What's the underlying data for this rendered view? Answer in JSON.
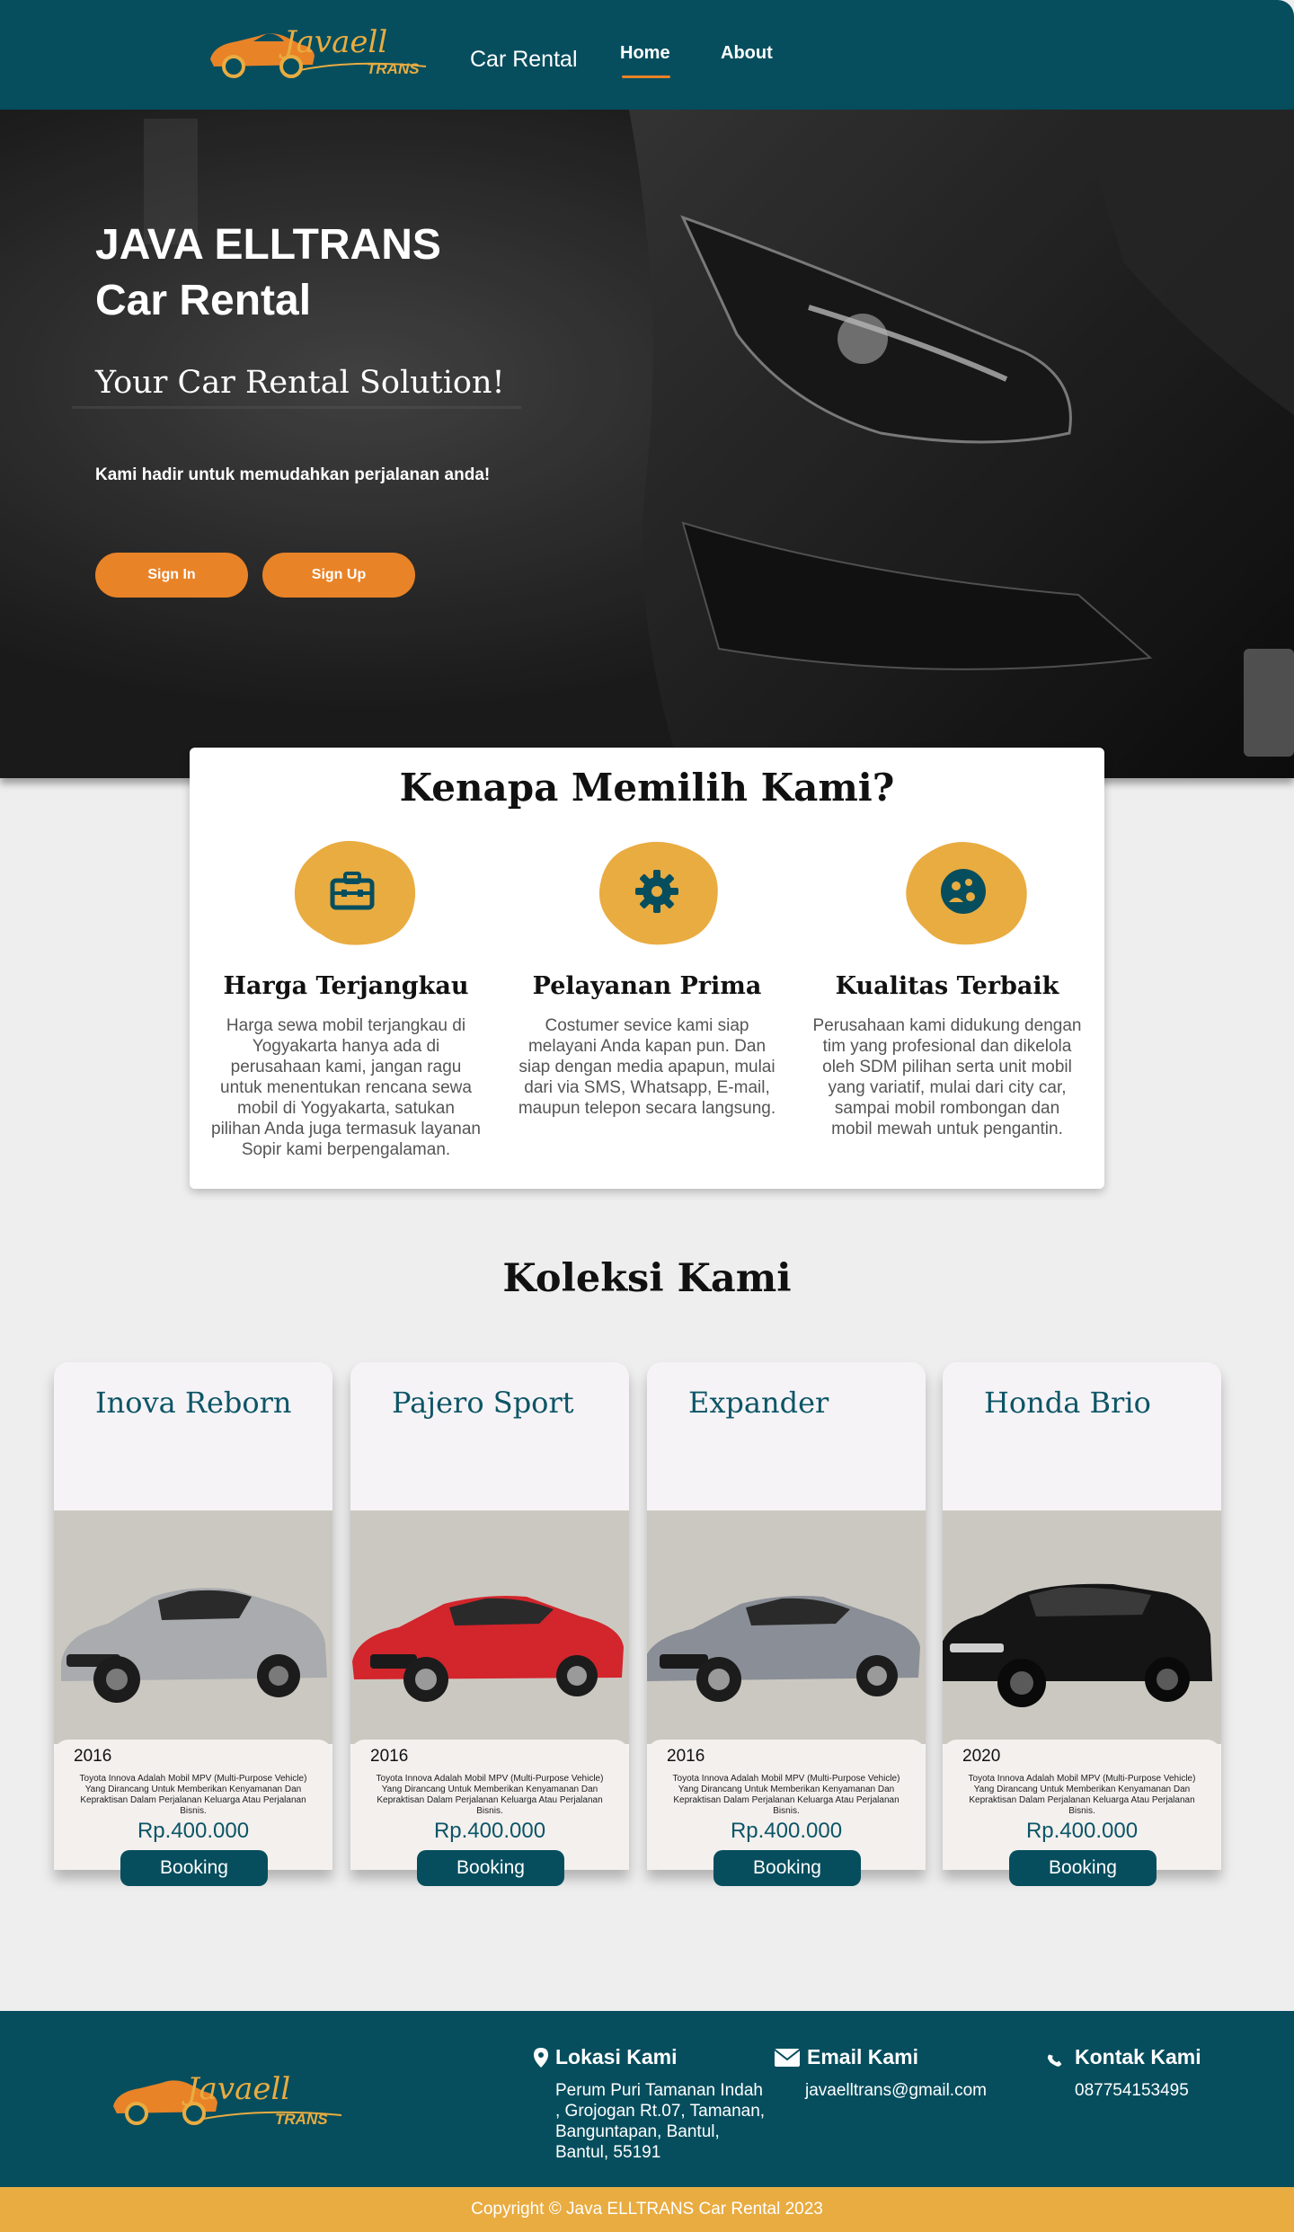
{
  "nav": {
    "logo_text": "Javaell TRANS",
    "brand": "Car Rental",
    "links": [
      {
        "label": "Home",
        "active": true
      },
      {
        "label": "About",
        "active": false
      }
    ]
  },
  "hero": {
    "title_line1": "JAVA ELLTRANS",
    "title_line2": "Car Rental",
    "subtitle": "Your Car Rental Solution!",
    "text": "Kami hadir untuk memudahkan perjalanan anda!",
    "signin_label": "Sign In",
    "signup_label": "Sign Up"
  },
  "why": {
    "title": "Kenapa Memilih Kami?",
    "features": [
      {
        "icon": "briefcase-icon",
        "title": "Harga Terjangkau",
        "desc": "Harga sewa mobil terjangkau di Yogyakarta hanya ada di perusahaan kami, jangan ragu untuk menentukan rencana sewa mobil di Yogyakarta, satukan pilihan Anda juga termasuk layanan Sopir kami berpengalaman."
      },
      {
        "icon": "gear-icon",
        "title": "Pelayanan Prima",
        "desc": "Costumer sevice kami siap melayani Anda kapan pun. Dan siap dengan media apapun, mulai dari via SMS, Whatsapp, E-mail, maupun telepon secara langsung."
      },
      {
        "icon": "team-icon",
        "title": "Kualitas Terbaik",
        "desc": "Perusahaan kami didukung dengan tim yang profesional dan dikelola oleh SDM pilihan serta unit mobil yang variatif, mulai dari city car, sampai mobil rombongan dan mobil mewah untuk pengantin."
      }
    ]
  },
  "collection": {
    "title": "Koleksi Kami",
    "booking_label": "Booking",
    "cars": [
      {
        "name": "Inova Reborn",
        "year": "2016",
        "color": "#a9abae",
        "desc": "Toyota Innova Adalah Mobil MPV (Multi-Purpose Vehicle) Yang Dirancang Untuk Memberikan Kenyamanan Dan Kepraktisan Dalam Perjalanan Keluarga Atau Perjalanan Bisnis.",
        "price": "Rp.400.000"
      },
      {
        "name": "Pajero Sport",
        "year": "2016",
        "color": "#d3252c",
        "desc": "Toyota Innova Adalah Mobil MPV (Multi-Purpose Vehicle) Yang Dirancang Untuk Memberikan Kenyamanan Dan Kepraktisan Dalam Perjalanan Keluarga Atau Perjalanan Bisnis.",
        "price": "Rp.400.000"
      },
      {
        "name": "Expander",
        "year": "2016",
        "color": "#8a8e96",
        "desc": "Toyota Innova Adalah Mobil MPV (Multi-Purpose Vehicle) Yang Dirancang Untuk Memberikan Kenyamanan Dan Kepraktisan Dalam Perjalanan Keluarga Atau Perjalanan Bisnis.",
        "price": "Rp.400.000"
      },
      {
        "name": "Honda Brio",
        "year": "2020",
        "color": "#151515",
        "desc": "Toyota Innova Adalah Mobil MPV (Multi-Purpose Vehicle) Yang Dirancang Untuk Memberikan Kenyamanan Dan Kepraktisan Dalam Perjalanan Keluarga Atau Perjalanan Bisnis.",
        "price": "Rp.400.000"
      }
    ]
  },
  "footer": {
    "location_title": "Lokasi Kami",
    "location_text": "Perum Puri Tamanan Indah , Grojogan Rt.07, Tamanan, Banguntapan, Bantul, Bantul, 55191",
    "email_title": "Email Kami",
    "email_text": "javaelltrans@gmail.com",
    "contact_title": "Kontak Kami",
    "contact_text": "087754153495",
    "copyright": "Copyright © Java ELLTRANS Car Rental 2023"
  },
  "colors": {
    "primary": "#064e5e",
    "accent": "#e98327",
    "gold": "#e9ac41",
    "background": "#eeeeee"
  }
}
